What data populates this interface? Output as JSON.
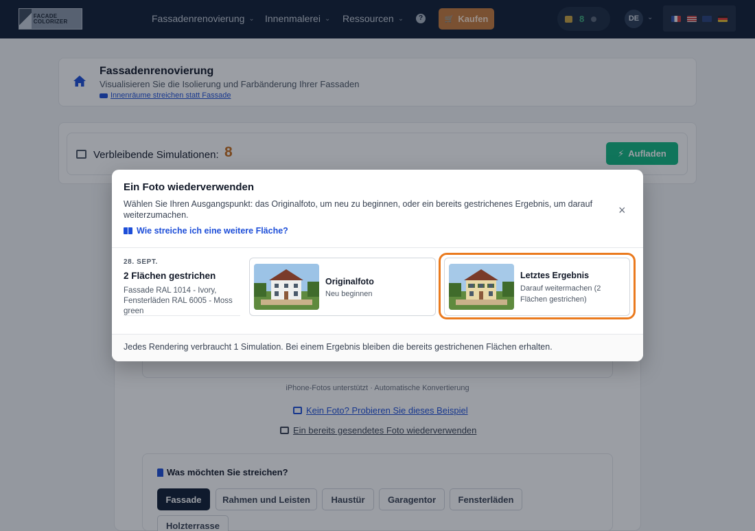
{
  "nav": {
    "logo_text": "FACADE COLORIZER",
    "logo_sub": "",
    "links": [
      "Fassadenrenovierung",
      "Innenmalerei",
      "Ressourcen"
    ],
    "help_label": "?",
    "buy_label": "Kaufen",
    "credits": "8",
    "language": "DE"
  },
  "header": {
    "title": "Fassadenrenovierung",
    "subtitle": "Visualisieren Sie die Isolierung und Farbänderung Ihrer Fassaden",
    "switch_link": "Innenräume streichen statt Fassade"
  },
  "simulations": {
    "label": "Verbleibende Simulationen:",
    "count": "8",
    "recharge_label": "Aufladen"
  },
  "upload": {
    "hint": "iPhone-Fotos unterstützt · Automatische Konvertierung",
    "example_link": "Kein Foto? Probieren Sie dieses Beispiel",
    "reuse_link": "Ein bereits gesendetes Foto wiederverwenden"
  },
  "paint": {
    "question": "Was möchten Sie streichen?",
    "options": [
      "Fassade",
      "Rahmen und Leisten",
      "Haustür",
      "Garagentor",
      "Fensterläden",
      "Holzterrasse"
    ],
    "active": "Fassade"
  },
  "modal": {
    "title": "Ein Foto wiederverwenden",
    "description": "Wählen Sie Ihren Ausgangspunkt: das Originalfoto, um neu zu beginnen, oder ein bereits gestrichenes Ergebnis, um darauf weiterzumachen.",
    "help_link": "Wie streiche ich eine weitere Fläche?",
    "close_label": "×",
    "entry": {
      "date": "28. SEPT.",
      "title": "2 Flächen gestrichen",
      "details": "Fassade RAL 1014 - Ivory, Fensterläden RAL 6005 - Moss green"
    },
    "original": {
      "title": "Originalfoto",
      "subtitle": "Neu beginnen"
    },
    "latest": {
      "title": "Letztes Ergebnis",
      "subtitle": "Darauf weitermachen (2 Flächen gestrichen)"
    },
    "footer": "Jedes Rendering verbraucht 1 Simulation. Bei einem Ergebnis bleiben die bereits gestrichenen Flächen erhalten."
  },
  "colors": {
    "nav_bg": "#0f1d33",
    "accent_orange": "#ea7a1e",
    "link_blue": "#1d4ed8",
    "success_green": "#10b981"
  }
}
